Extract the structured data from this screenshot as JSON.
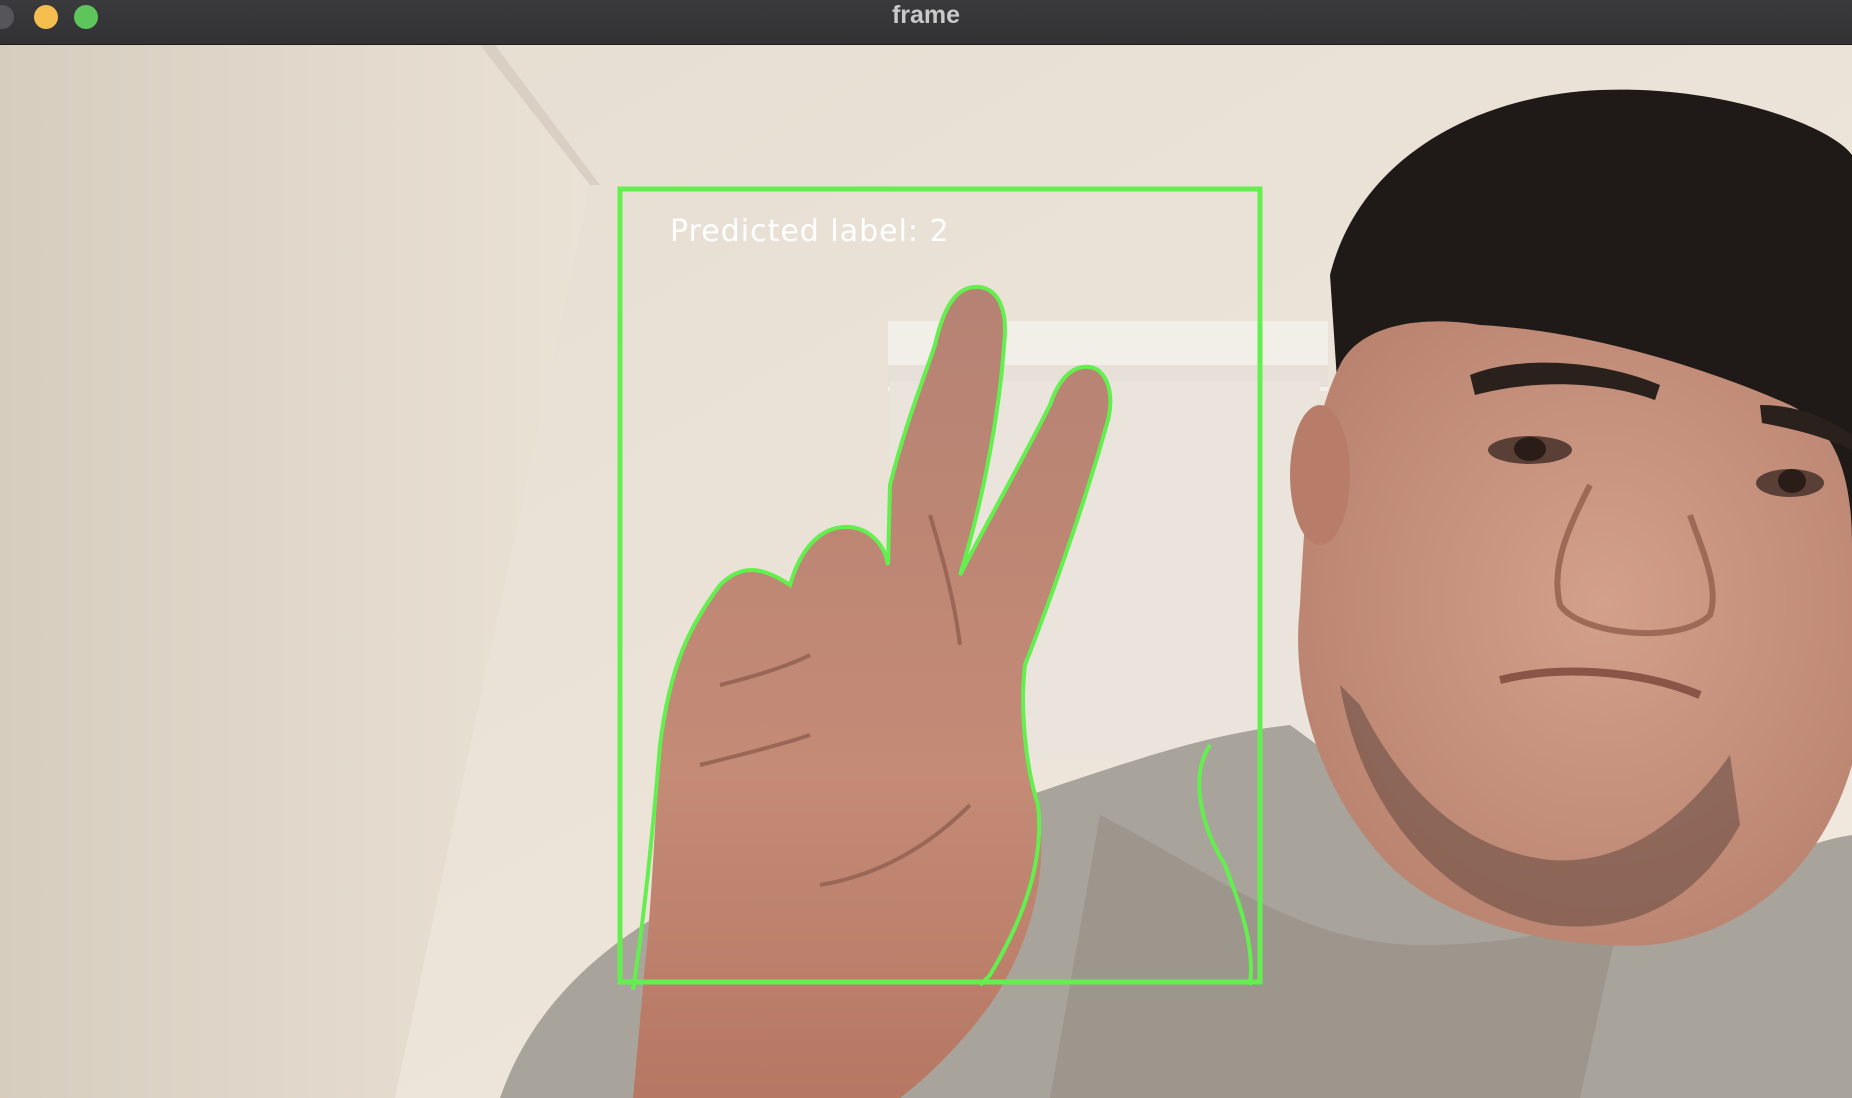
{
  "window": {
    "title": "frame"
  },
  "overlay": {
    "label_text": "Predicted label: 2",
    "box_color": "#63f04f",
    "text_color": "#ffffff"
  },
  "icons": [
    "close-button",
    "minimize-button",
    "zoom-button"
  ]
}
